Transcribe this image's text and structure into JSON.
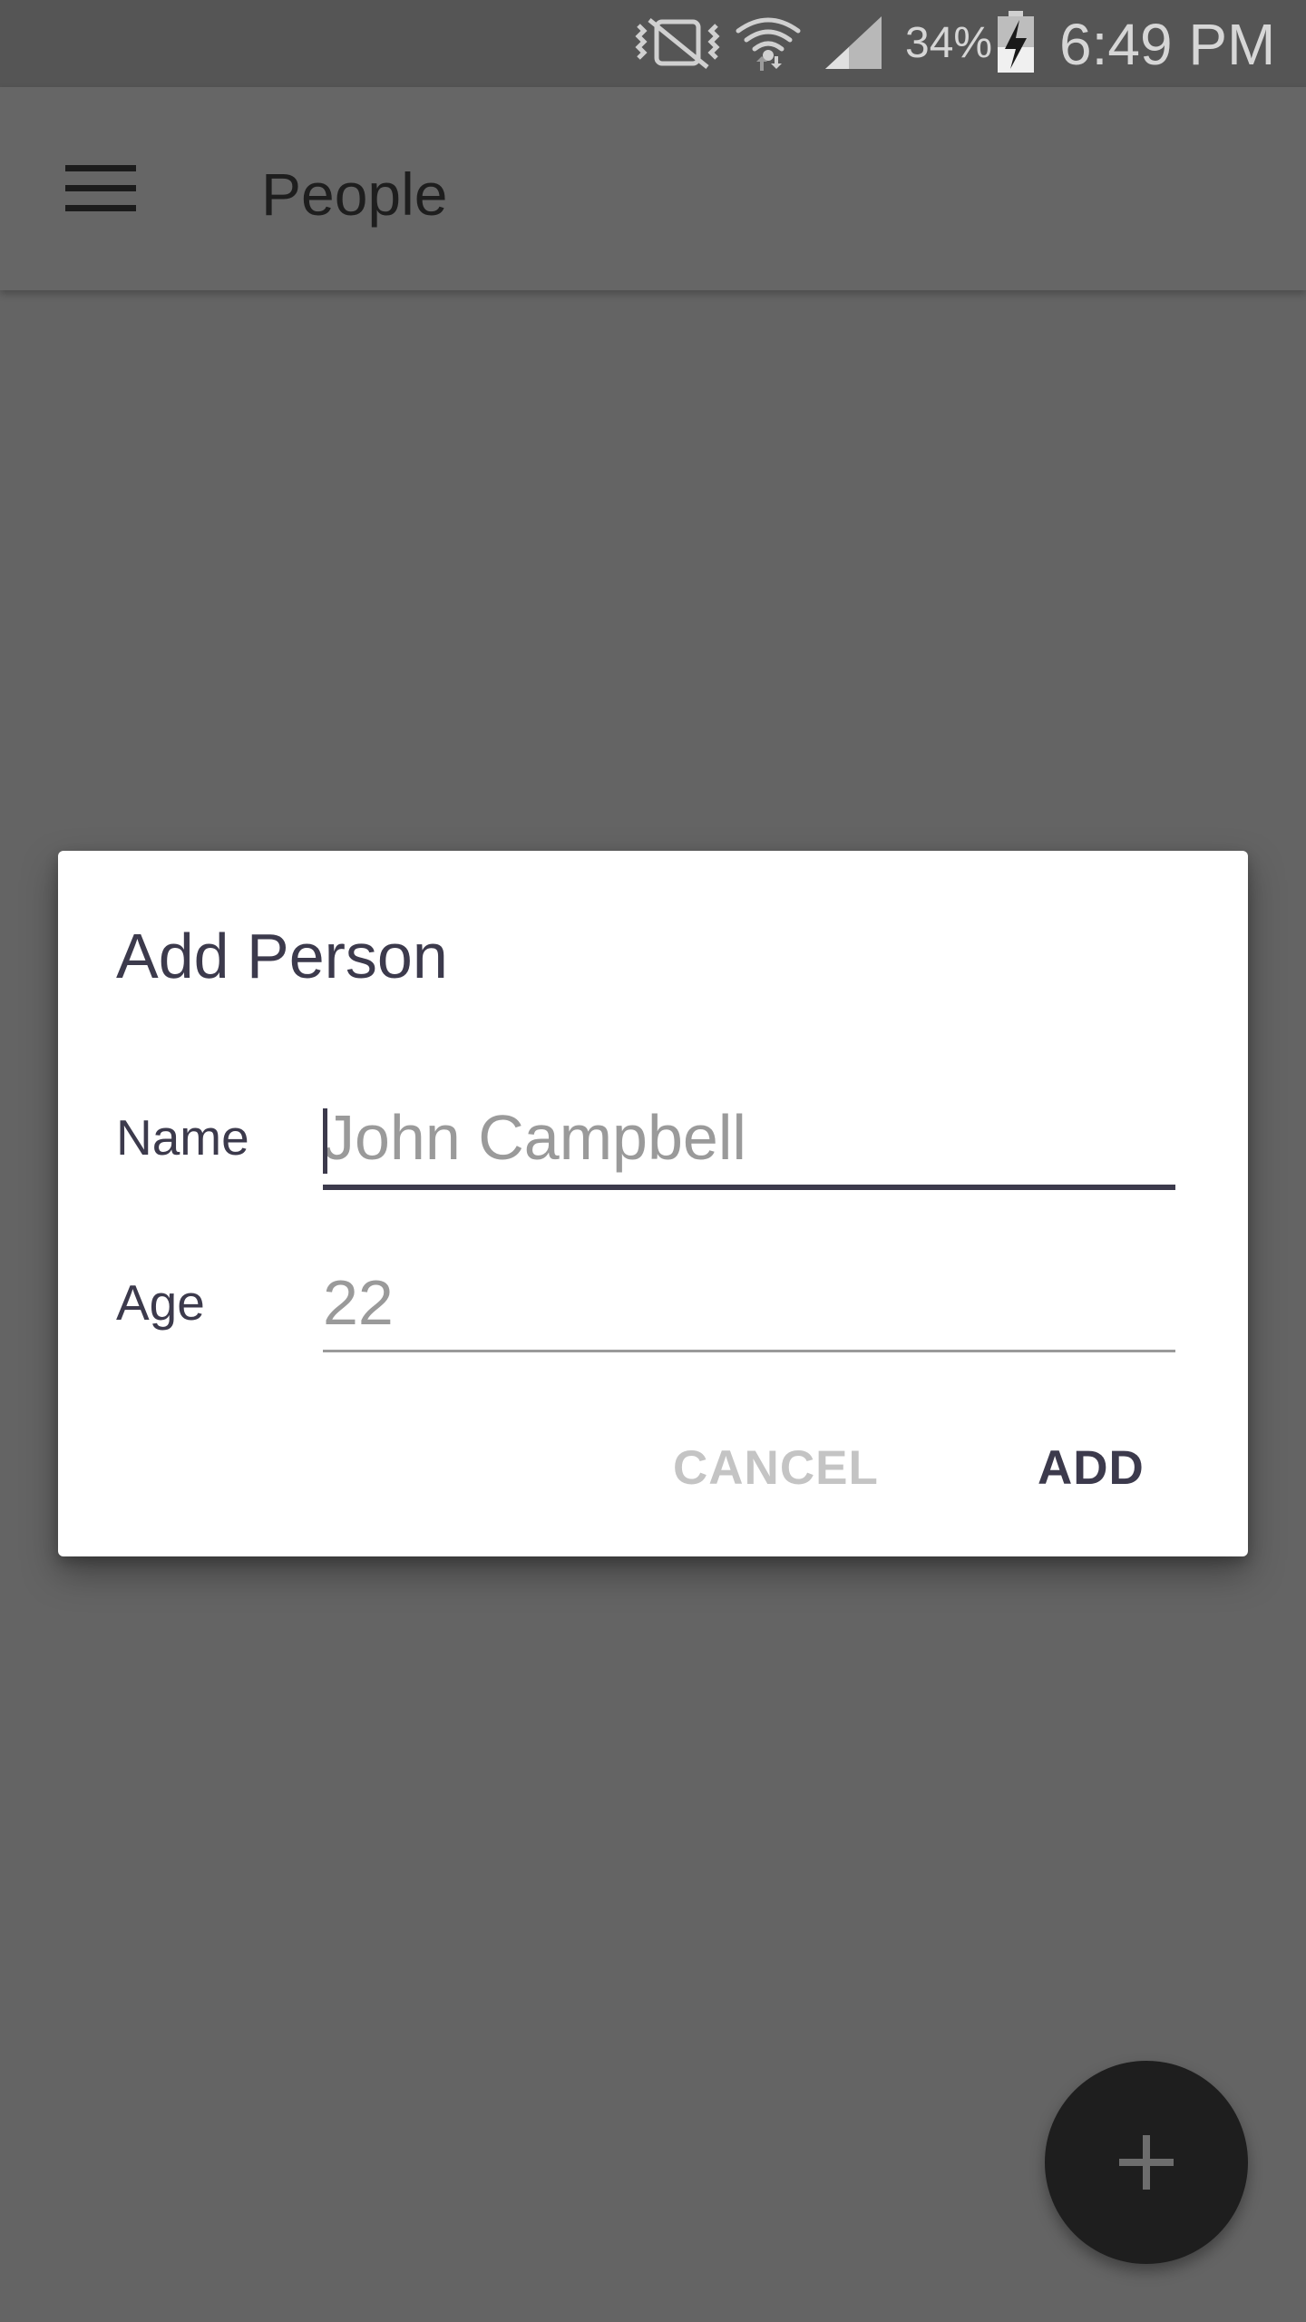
{
  "status_bar": {
    "battery_percent": "34%",
    "time": "6:49 PM",
    "icons": [
      "vibrate-mute-icon",
      "wifi-icon",
      "cell-signal-icon",
      "battery-charging-icon"
    ]
  },
  "app_bar": {
    "title": "People",
    "menu_icon": "hamburger-menu-icon"
  },
  "dialog": {
    "title": "Add Person",
    "fields": {
      "name": {
        "label": "Name",
        "placeholder": "John Campbell",
        "value": ""
      },
      "age": {
        "label": "Age",
        "placeholder": "22",
        "value": ""
      }
    },
    "buttons": {
      "cancel": "CANCEL",
      "add": "ADD"
    }
  },
  "fab": {
    "icon": "plus-icon"
  },
  "colors": {
    "scrim_background": "#646464",
    "status_bar": "#555555",
    "dialog_text": "#3c3a4c",
    "placeholder_text": "#9a9a9a",
    "cancel_disabled": "#c4c4c4",
    "fab": "#1e1e1e"
  }
}
